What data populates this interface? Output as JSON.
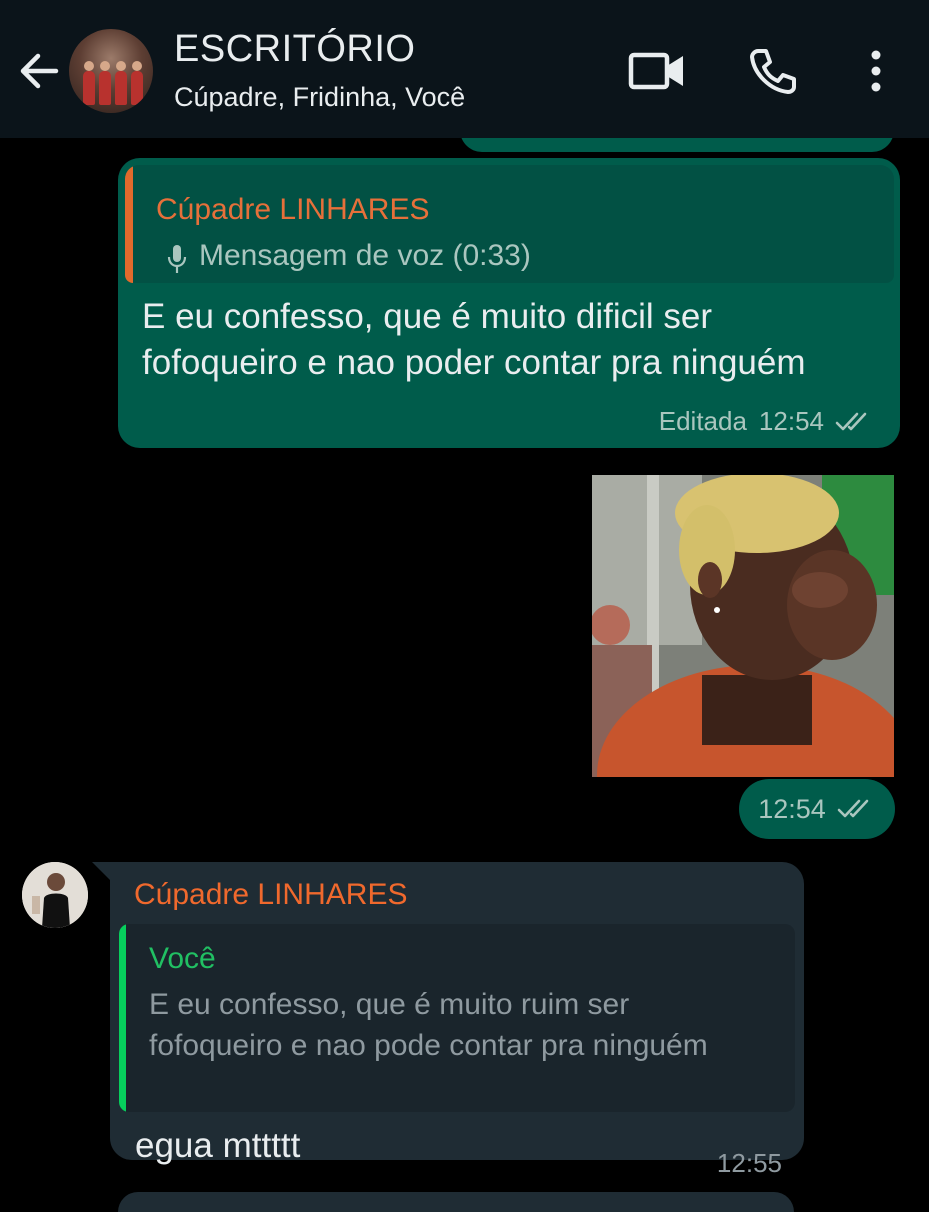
{
  "header": {
    "title": "ESCRITÓRIO",
    "subtitle": "Cúpadre, Fridinha, Você"
  },
  "messages": {
    "outgoing_edited": {
      "quote": {
        "sender": "Cúpadre LINHARES",
        "snippet": "Mensagem de voz (0:33)",
        "icon": "mic-icon"
      },
      "text": "E eu confesso,  que é muito dificil ser fofoqueiro e nao poder contar pra ninguém",
      "edited_label": "Editada",
      "time": "12:54",
      "status": "read"
    },
    "outgoing_sticker": {
      "time": "12:54",
      "status": "read"
    },
    "incoming_reply": {
      "sender": "Cúpadre LINHARES",
      "quote": {
        "sender": "Você",
        "text": "E eu confesso,  que é muito ruim ser fofoqueiro e nao pode contar pra ninguém"
      },
      "text": "egua mttttt",
      "time": "12:55"
    }
  },
  "colors": {
    "header_bg": "#0b141a",
    "outgoing_bubble": "#005c4b",
    "incoming_bubble": "#1f2c34",
    "sender_orange": "#f0692d",
    "quote_green": "#06cf5c"
  }
}
